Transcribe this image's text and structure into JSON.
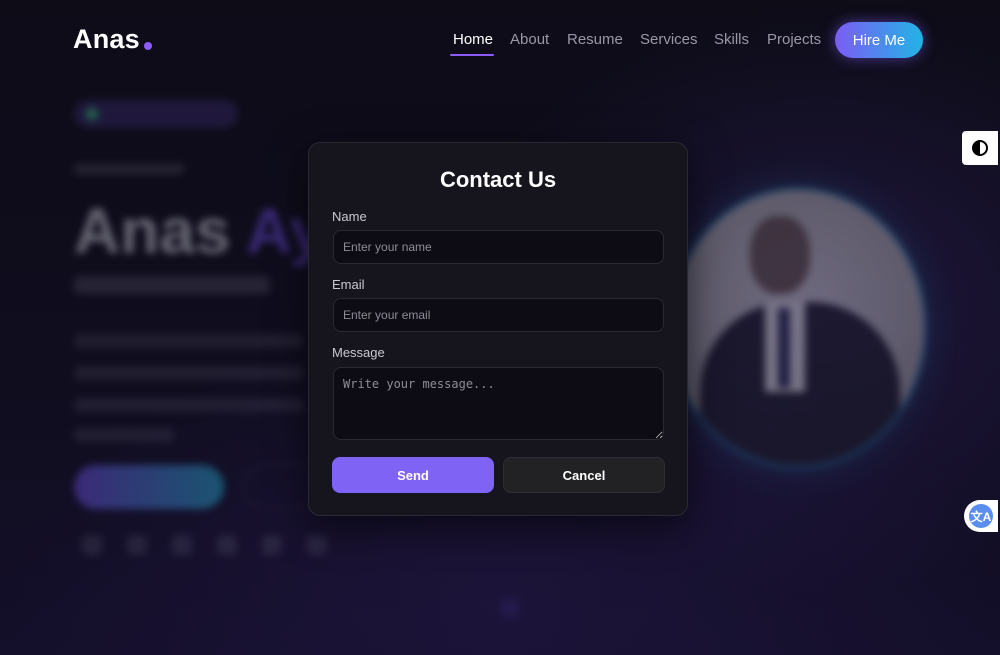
{
  "nav": {
    "logo": "Anas",
    "links": [
      {
        "label": "Home",
        "active": true
      },
      {
        "label": "About",
        "active": false
      },
      {
        "label": "Resume",
        "active": false
      },
      {
        "label": "Services",
        "active": false
      },
      {
        "label": "Skills",
        "active": false
      },
      {
        "label": "Projects",
        "active": false
      }
    ],
    "hire_label": "Hire Me"
  },
  "hero": {
    "name_first": "Anas",
    "name_second": "Ay"
  },
  "side": {
    "theme_icon": "contrast-icon",
    "translate_icon": "translate-icon",
    "translate_glyph": "文A"
  },
  "modal": {
    "title": "Contact Us",
    "name_label": "Name",
    "name_placeholder": "Enter your name",
    "email_label": "Email",
    "email_placeholder": "Enter your email",
    "message_label": "Message",
    "message_placeholder": "Write your message...",
    "send_label": "Send",
    "cancel_label": "Cancel"
  },
  "colors": {
    "accent": "#7e63f5",
    "accent_gradient_end": "#22b4e6",
    "modal_bg": "#16151d",
    "page_bg": "#0b0a14"
  }
}
